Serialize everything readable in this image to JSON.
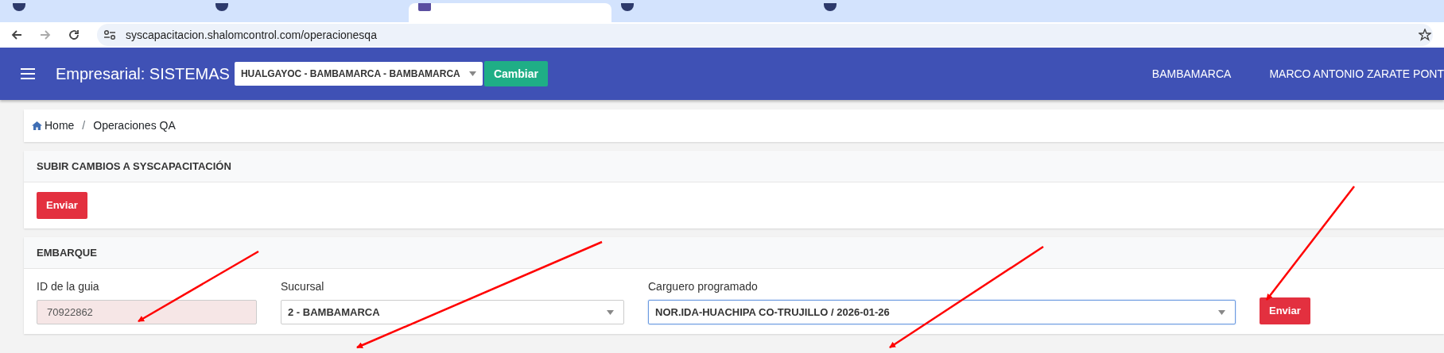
{
  "browser": {
    "tabs": [
      {
        "selected": false
      },
      {
        "selected": false
      },
      {
        "selected": true
      },
      {
        "selected": false
      },
      {
        "selected": false
      }
    ],
    "url": "syscapacitacion.shalomcontrol.com/operacionesqa"
  },
  "navbar": {
    "title": "Empresarial: SISTEMAS",
    "branch_select": {
      "value": "HUALGAYOC - BAMBAMARCA - BAMBAMARCA"
    },
    "change_button": "Cambiar",
    "right_items": [
      "BAMBAMARCA",
      "MARCO ANTONIO ZARATE PONT"
    ]
  },
  "breadcrumb": {
    "separator": "/",
    "items": [
      {
        "label": "Home",
        "kind": "home"
      },
      {
        "label": "Operaciones QA",
        "kind": "page"
      }
    ]
  },
  "sections": [
    {
      "title": "SUBIR CAMBIOS A SYSCAPACITACIÓN",
      "button": "Enviar"
    },
    {
      "title": "EMBARQUE",
      "fields": [
        {
          "kind": "input",
          "label": "ID de la guia",
          "value": "70922862",
          "readonly": true,
          "focused": false
        },
        {
          "kind": "select",
          "label": "Sucursal",
          "value": "2 - BAMBAMARCA",
          "readonly": false,
          "focused": false
        },
        {
          "kind": "select",
          "label": "Carguero programado",
          "value": "NOR.IDA-HUACHIPA CO-TRUJILLO / 2026-01-26",
          "readonly": false,
          "focused": true
        }
      ],
      "button": "Enviar"
    }
  ]
}
